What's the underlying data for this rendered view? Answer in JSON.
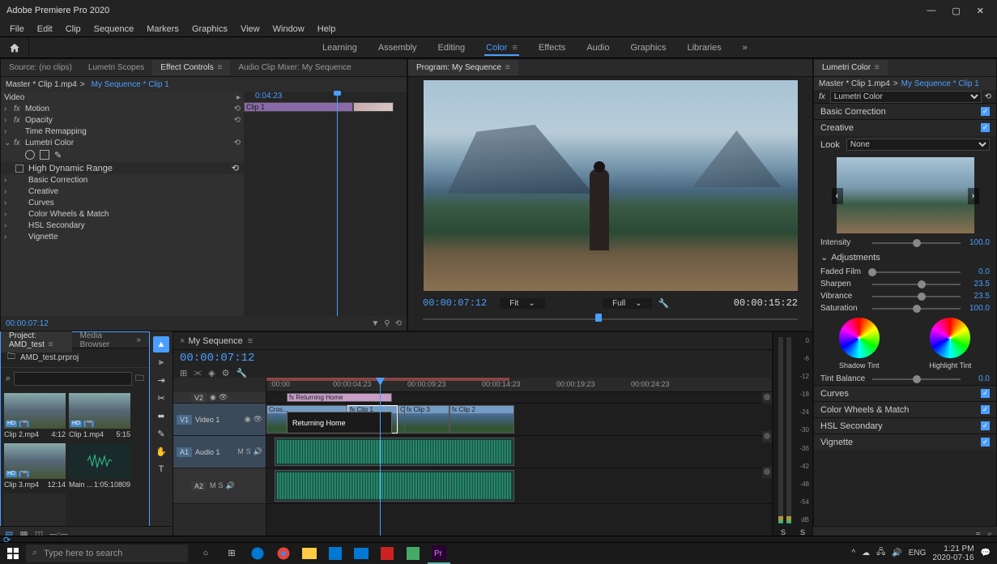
{
  "app_title": "Adobe Premiere Pro 2020",
  "menu": [
    "File",
    "Edit",
    "Clip",
    "Sequence",
    "Markers",
    "Graphics",
    "View",
    "Window",
    "Help"
  ],
  "workspaces": [
    "Learning",
    "Assembly",
    "Editing",
    "Color",
    "Effects",
    "Audio",
    "Graphics",
    "Libraries"
  ],
  "workspace_active": "Color",
  "source_panel": {
    "tabs": [
      "Source: (no clips)",
      "Lumetri Scopes",
      "Effect Controls",
      "Audio Clip Mixer: My Sequence"
    ],
    "active_tab": "Effect Controls"
  },
  "effect_controls": {
    "master": "Master * Clip 1.mp4",
    "seq_link": "My Sequence * Clip 1",
    "timecode_head": "0:04:23",
    "clip_label": "Clip 1",
    "rows": {
      "video": "Video",
      "motion": "Motion",
      "opacity": "Opacity",
      "time_remap": "Time Remapping",
      "lumetri": "Lumetri Color",
      "hdr": "High Dynamic Range",
      "basic": "Basic Correction",
      "creative": "Creative",
      "curves": "Curves",
      "wheels": "Color Wheels & Match",
      "hsl": "HSL Secondary",
      "vignette": "Vignette"
    },
    "current_tc": "00:00:07:12"
  },
  "program": {
    "title": "Program: My Sequence",
    "timecode": "00:00:07:12",
    "fit": "Fit",
    "scale": "Full",
    "duration": "00:00:15:22"
  },
  "lumetri": {
    "title": "Lumetri Color",
    "master": "Master * Clip 1.mp4",
    "seq_link": "My Sequence * Clip 1",
    "fx_name": "Lumetri Color",
    "sections": {
      "basic": "Basic Correction",
      "creative": "Creative",
      "curves": "Curves",
      "wheels": "Color Wheels & Match",
      "hsl": "HSL Secondary",
      "vignette": "Vignette"
    },
    "look_label": "Look",
    "look_value": "None",
    "intensity": {
      "label": "Intensity",
      "value": "100.0",
      "pos": 50
    },
    "adjustments": "Adjustments",
    "faded": {
      "label": "Faded Film",
      "value": "0.0",
      "pos": 0
    },
    "sharpen": {
      "label": "Sharpen",
      "value": "23.5",
      "pos": 56
    },
    "vibrance": {
      "label": "Vibrance",
      "value": "23.5",
      "pos": 56
    },
    "saturation": {
      "label": "Saturation",
      "value": "100.0",
      "pos": 50
    },
    "shadow_tint": "Shadow Tint",
    "highlight_tint": "Highlight Tint",
    "tint_balance": {
      "label": "Tint Balance",
      "value": "0.0",
      "pos": 50
    }
  },
  "project": {
    "tab": "Project: AMD_test",
    "media_browser": "Media Browser",
    "filename": "AMD_test.prproj",
    "clips": [
      {
        "name": "Clip 2.mp4",
        "dur": "4:12"
      },
      {
        "name": "Clip 1.mp4",
        "dur": "5:15"
      },
      {
        "name": "Clip 3.mp4",
        "dur": "12:14"
      },
      {
        "name": "Main ...",
        "dur": "1:05:10809",
        "audio": true
      }
    ]
  },
  "timeline": {
    "title": "My Sequence",
    "timecode": "00:00:07:12",
    "ruler": [
      ":00:00",
      "00:00:04:23",
      "00:00:09:23",
      "00:00:14:23",
      "00:00:19:23",
      "00:00:24:23"
    ],
    "tracks": {
      "v2": "V2",
      "v1": "V1",
      "video1": "Video 1",
      "a1": "A1",
      "audio1": "Audio 1",
      "a2": "A2"
    },
    "clips": {
      "graphic": "Returning Home",
      "graphic_body": "Returning Home",
      "c1": "Clip 1",
      "c2": "Clip 2",
      "c3": "Clip 3",
      "c4": "Clip 2",
      "cross": "Cros...",
      "cross2": "Cross D"
    }
  },
  "meters": {
    "scale": [
      "0",
      "-6",
      "-12",
      "-18",
      "-24",
      "-30",
      "-36",
      "-42",
      "-48",
      "-54",
      "dB"
    ],
    "s": "S"
  },
  "taskbar": {
    "search_placeholder": "Type here to search",
    "lang": "ENG",
    "time": "1:21 PM",
    "date": "2020-07-16"
  }
}
